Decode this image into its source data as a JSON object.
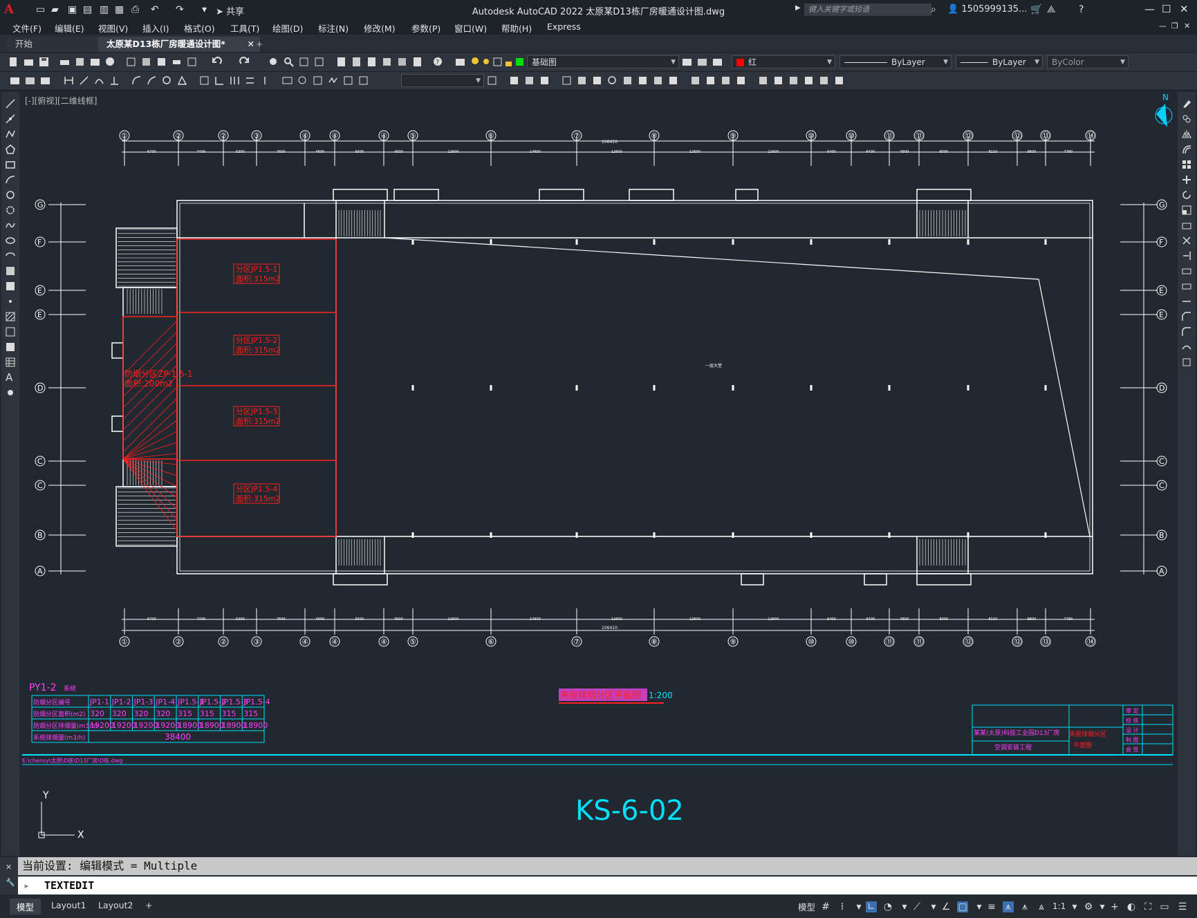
{
  "titlebar": {
    "app_logo": "A",
    "title": "Autodesk AutoCAD 2022    太原某D13栋厂房暖通设计图.dwg",
    "share_label": "共享",
    "search_placeholder": "键入关键字或短语",
    "user": "1505999135...",
    "minimize": "—",
    "restore": "☐",
    "close": "✕"
  },
  "menu": [
    "文件(F)",
    "编辑(E)",
    "视图(V)",
    "插入(I)",
    "格式(O)",
    "工具(T)",
    "绘图(D)",
    "标注(N)",
    "修改(M)",
    "参数(P)",
    "窗口(W)",
    "帮助(H)",
    "Express"
  ],
  "tabs": {
    "start": "开始",
    "drawing": "太原某D13栋厂房暖通设计图*",
    "close": "✕",
    "add": "+"
  },
  "properties": {
    "layer": "基础图",
    "color": "红",
    "linetype": "ByLayer",
    "lineweight": "ByLayer",
    "plotstyle": "ByColor"
  },
  "view_label": "[-][俯视][二维线框]",
  "compass": "N",
  "drawing": {
    "grid_columns": [
      "①",
      "②",
      "②",
      "③",
      "④",
      "④",
      "④",
      "⑤",
      "⑥",
      "⑦",
      "⑧",
      "⑨",
      "⑩",
      "⑩",
      "⑪",
      "⑪",
      "⑫",
      "⑫",
      "⑬",
      "⑭"
    ],
    "grid_rows": [
      "G",
      "F",
      "E",
      "E",
      "D",
      "C",
      "C",
      "B",
      "A"
    ],
    "dims_top": [
      "6700",
      "7400",
      "5300",
      "7600",
      "4600",
      "5500",
      "4500",
      "12600",
      "14600",
      "12600",
      "12600",
      "12600",
      "6400",
      "6400",
      "4800",
      "8000",
      "8110",
      "9800",
      "7790"
    ],
    "total_dim": "106410",
    "zones": [
      {
        "name": "分区JP1.5-1",
        "area": "面积:315m2"
      },
      {
        "name": "分区JP1.5-2",
        "area": "面积:315m2"
      },
      {
        "name": "分区JP1.5-3",
        "area": "面积:315m2"
      },
      {
        "name": "分区JP1.5-4",
        "area": "面积:315m2"
      }
    ],
    "zp_zone": {
      "name": "防烟分区ZP-1.5-1",
      "area": "面积:200m2"
    },
    "plan_title": "夹层排烟分区平面图",
    "scale": "1:200",
    "sheet_number": "KS-6-02",
    "file_path": "E:\\chensy\\太原\\D栋\\D13厂房\\D栋.dwg",
    "room_label": "一层大堂"
  },
  "table": {
    "title": "PY1-2",
    "title_suffix": "系统",
    "header_label": "防烟分区编号",
    "area_label": "防烟分区面积(m2)",
    "flow_label": "防烟分区排烟量(m3/h)",
    "total_label": "系统排烟量(m3/h)",
    "zone_ids": [
      "JP1-1",
      "JP1-2",
      "JP1-3",
      "JP1-4",
      "JP1.5-1",
      "JP1.5-2",
      "JP1.5-3",
      "JP1.5-4"
    ],
    "areas": [
      "320",
      "320",
      "320",
      "320",
      "315",
      "315",
      "315",
      "315"
    ],
    "flows": [
      "19200",
      "19200",
      "19200",
      "19200",
      "18900",
      "18900",
      "18900",
      "18900"
    ],
    "total": "38400"
  },
  "title_block": {
    "project": "某某(太原)科技工业园D13厂房",
    "subproject": "空调安装工程",
    "drawing_name": "夹层排烟分区",
    "drawing_name2": "平面图",
    "rows": [
      "审 定",
      "校 核",
      "设 计",
      "制 图",
      "会 签"
    ]
  },
  "command": {
    "history": "当前设置: 编辑模式 = Multiple",
    "input": "TEXTEDIT"
  },
  "status": {
    "tabs": [
      "模型",
      "Layout1",
      "Layout2"
    ],
    "add": "+",
    "model_btn": "模型",
    "scale": "1:1"
  }
}
